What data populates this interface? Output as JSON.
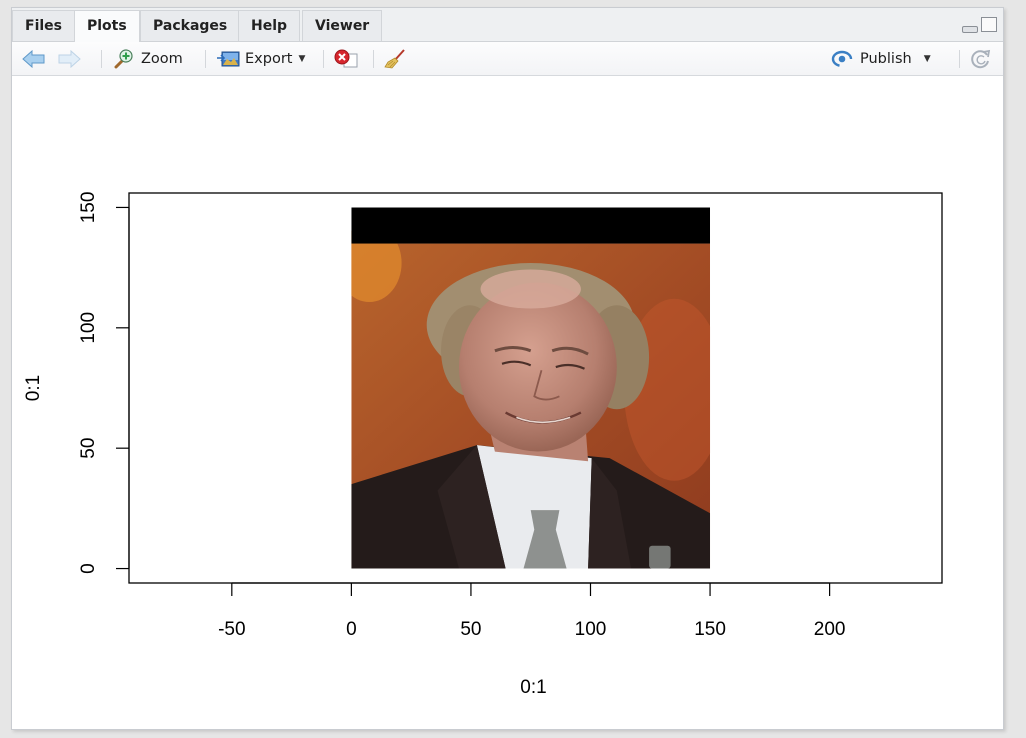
{
  "tabs": [
    {
      "label": "Files",
      "active": false
    },
    {
      "label": "Plots",
      "active": true
    },
    {
      "label": "Packages",
      "active": false
    },
    {
      "label": "Help",
      "active": false
    },
    {
      "label": "Viewer",
      "active": false
    }
  ],
  "toolbar": {
    "back_icon": "arrow-left-icon",
    "forward_icon": "arrow-right-icon",
    "zoom_label": "Zoom",
    "export_label": "Export",
    "remove_icon": "remove-plot-icon",
    "clear_icon": "broom-icon",
    "publish_label": "Publish",
    "refresh_icon": "refresh-icon"
  },
  "colors": {
    "publish_accent": "#3a7fc4",
    "back_arrow": "#8cbde6",
    "image_background": "#a9502a",
    "image_band": "#000000"
  },
  "chart_data": {
    "type": "scatter",
    "title": "",
    "xlabel": "0:1",
    "ylabel": "0:1",
    "xlim": [
      -93,
      247
    ],
    "ylim": [
      -6,
      156
    ],
    "x_ticks": [
      -50,
      0,
      50,
      100,
      150,
      200
    ],
    "x_tick_labels": [
      "-50",
      "0",
      "50",
      "100",
      "150",
      "200"
    ],
    "y_ticks": [
      0,
      50,
      100,
      150
    ],
    "y_tick_labels": [
      "0",
      "50",
      "100",
      "150"
    ],
    "grid": false,
    "legend": "none",
    "raster_image": {
      "description": "photo of a smiling man in a dark suit and tie against an orange background",
      "x_range": [
        0,
        150
      ],
      "y_range": [
        0,
        150
      ],
      "black_band_y_range": [
        135,
        150
      ]
    }
  }
}
